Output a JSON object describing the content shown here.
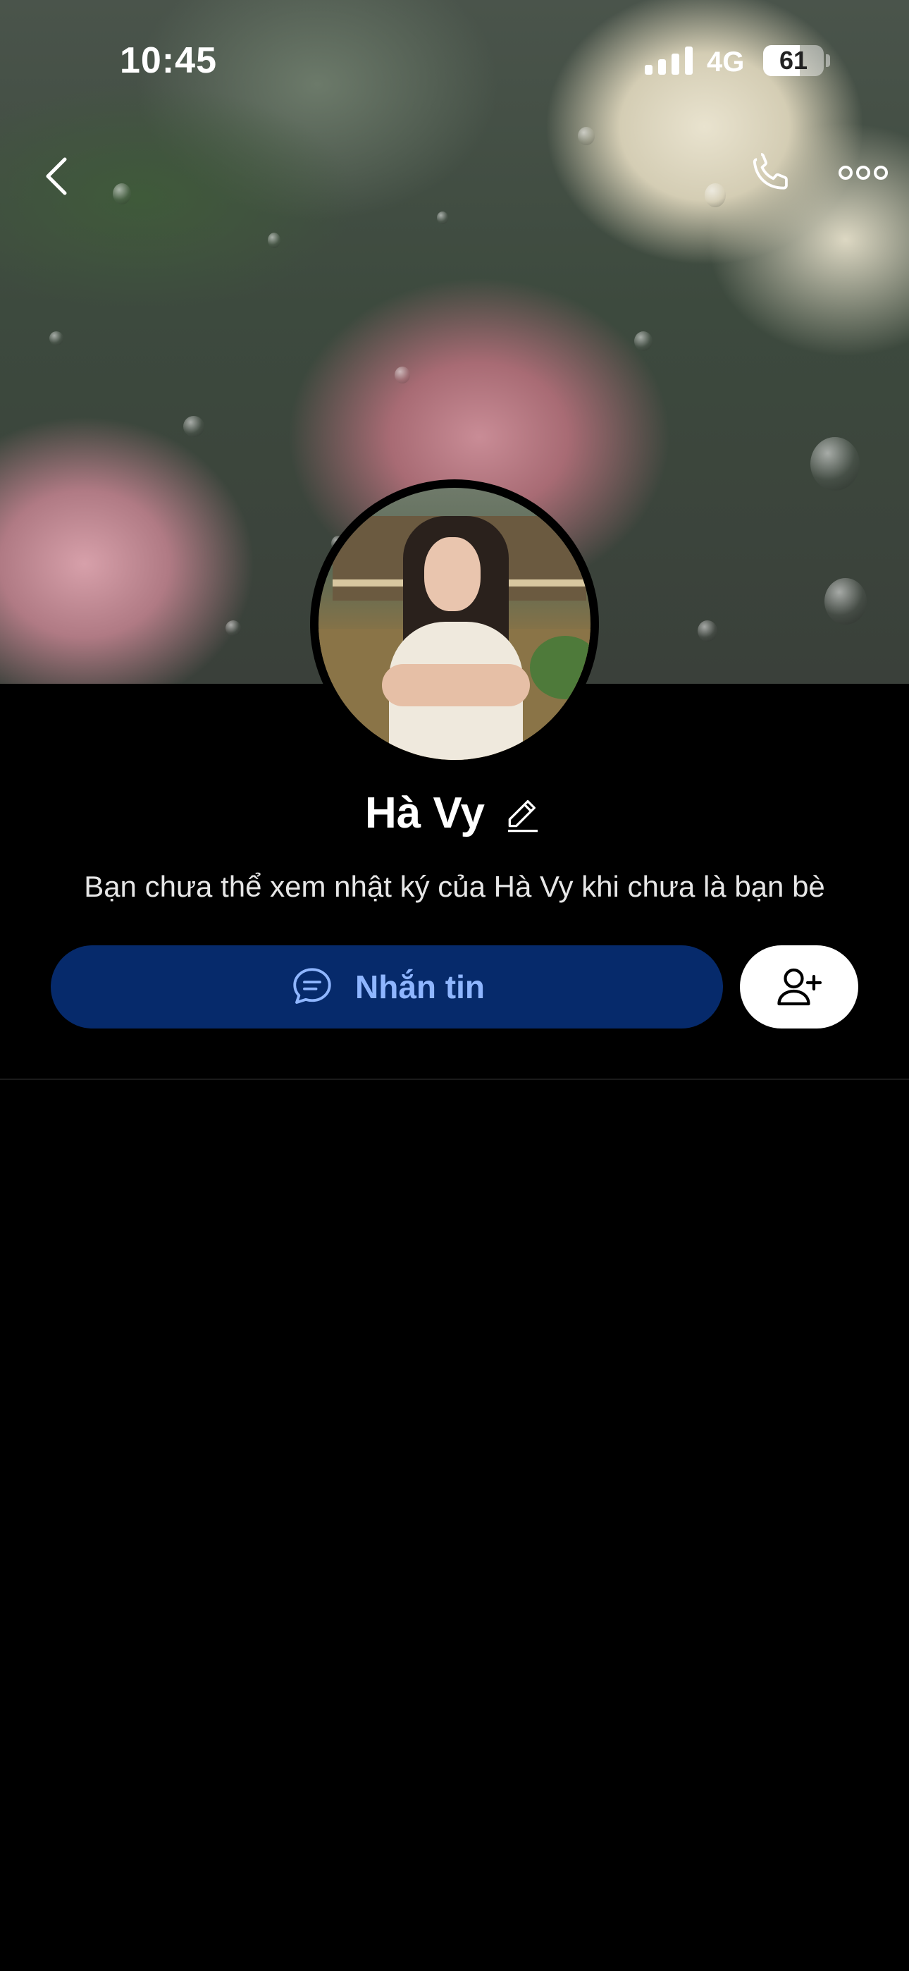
{
  "status_bar": {
    "time": "10:45",
    "network": "4G",
    "battery": "61",
    "battery_level": 0.61
  },
  "nav": {
    "back_icon": "chevron-left-icon",
    "call_icon": "phone-icon",
    "more_icon": "ellipsis-icon"
  },
  "profile": {
    "name": "Hà Vy",
    "edit_icon": "pencil-icon",
    "info": "Bạn chưa thể xem nhật ký của Hà Vy khi chưa là bạn bè"
  },
  "actions": {
    "message_label": "Nhắn tin",
    "message_icon": "chat-bubble-icon",
    "add_friend_icon": "add-user-icon"
  },
  "colors": {
    "background": "#000000",
    "message_button_bg": "#062a6b",
    "message_button_text": "#8fb6ff",
    "add_friend_bg": "#ffffff"
  }
}
